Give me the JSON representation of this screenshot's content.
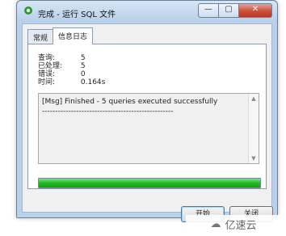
{
  "window": {
    "title": "完成 - 运行 SQL 文件",
    "controls": {
      "minimize": "—",
      "maximize": "▢",
      "close": "✕"
    }
  },
  "tabs": [
    {
      "label": "常规"
    },
    {
      "label": "信息日志"
    }
  ],
  "stats": [
    {
      "label": "查询:",
      "value": "5"
    },
    {
      "label": "已处理:",
      "value": "5"
    },
    {
      "label": "错误:",
      "value": "0"
    },
    {
      "label": "时间:",
      "value": "0.164s"
    }
  ],
  "log": {
    "line1": "[Msg] Finished - 5 queries executed successfully",
    "line2": "--------------------------------------------------"
  },
  "progress": {
    "value": 1.0,
    "color": "#22c122"
  },
  "buttons": {
    "start": "开始",
    "close": "关闭"
  },
  "watermark": {
    "text": "亿速云"
  }
}
